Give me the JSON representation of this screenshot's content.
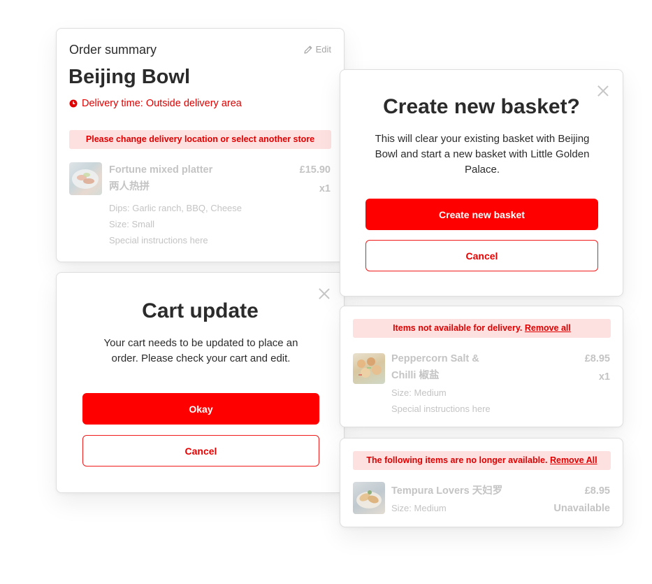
{
  "order_summary": {
    "heading": "Order summary",
    "edit_label": "Edit",
    "store_name": "Beijing Bowl",
    "delivery_label": "Delivery time:",
    "delivery_value": "Outside delivery area",
    "warning": "Please change delivery location or select another store",
    "item": {
      "name": "Fortune mixed platter",
      "name_cn": "两人热拼",
      "price": "£15.90",
      "qty": "x1",
      "dips": "Dips: Garlic ranch, BBQ, Cheese",
      "size": "Size: Small",
      "instructions": "Special instructions here"
    }
  },
  "cart_update": {
    "title": "Cart update",
    "body": "Your cart needs to be updated to place an order. Please check your cart and edit.",
    "okay_label": "Okay",
    "cancel_label": "Cancel"
  },
  "new_basket": {
    "title": "Create new basket?",
    "body": "This will clear your existing basket with Beijing Bowl and start a new basket with Little Golden Palace.",
    "create_label": "Create new basket",
    "cancel_label": "Cancel"
  },
  "not_available_delivery": {
    "banner_text": "Items not available for delivery.",
    "banner_link": "Remove all",
    "item": {
      "name": "Peppercorn Salt & Chilli 椒盐",
      "price": "£8.95",
      "qty": "x1",
      "size": "Size: Medium",
      "instructions": "Special instructions here"
    }
  },
  "no_longer_available": {
    "banner_text": "The following items are no longer available.",
    "banner_link": "Remove All",
    "item": {
      "name": "Tempura Lovers 天妇罗",
      "price": "£8.95",
      "status": "Unavailable",
      "size": "Size: Medium"
    }
  },
  "colors": {
    "accent": "#fe0000",
    "banner_bg": "#fde0e0",
    "muted_text": "#c4c4c4"
  },
  "icons": {
    "edit": "pencil-icon",
    "delivery": "clock-icon",
    "close": "close-icon"
  }
}
